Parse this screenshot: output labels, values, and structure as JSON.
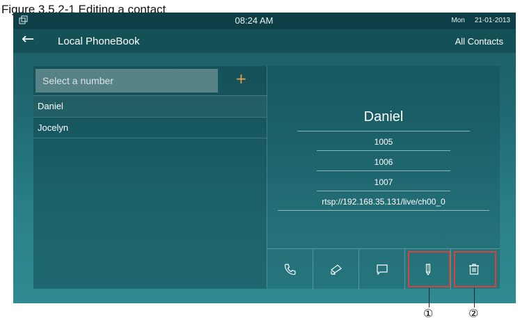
{
  "caption": "Figure 3.5.2-1 Editing a contact",
  "statusbar": {
    "time": "08:24 AM",
    "day": "Mon",
    "date": "21-01-2013",
    "icon": "window-icon"
  },
  "header": {
    "back_icon": "←",
    "title": "Local PhoneBook",
    "filter_label": "All Contacts"
  },
  "search": {
    "placeholder": "Select a number",
    "add_icon": "+"
  },
  "contacts": [
    {
      "name": "Daniel",
      "selected": true
    },
    {
      "name": "Jocelyn",
      "selected": false
    }
  ],
  "detail": {
    "name": "Daniel",
    "numbers": [
      "1005",
      "1006",
      "1007"
    ],
    "stream_url": "rtsp://192.168.35.131/live/ch00_0"
  },
  "actions": [
    "phone-icon",
    "camera-icon",
    "message-icon",
    "edit-icon",
    "delete-icon"
  ],
  "callouts": {
    "edit": "①",
    "delete": "②"
  },
  "colors": {
    "highlight": "#d9423a",
    "accent": "#e8a34a",
    "screen_bg": "#1f6a72"
  }
}
